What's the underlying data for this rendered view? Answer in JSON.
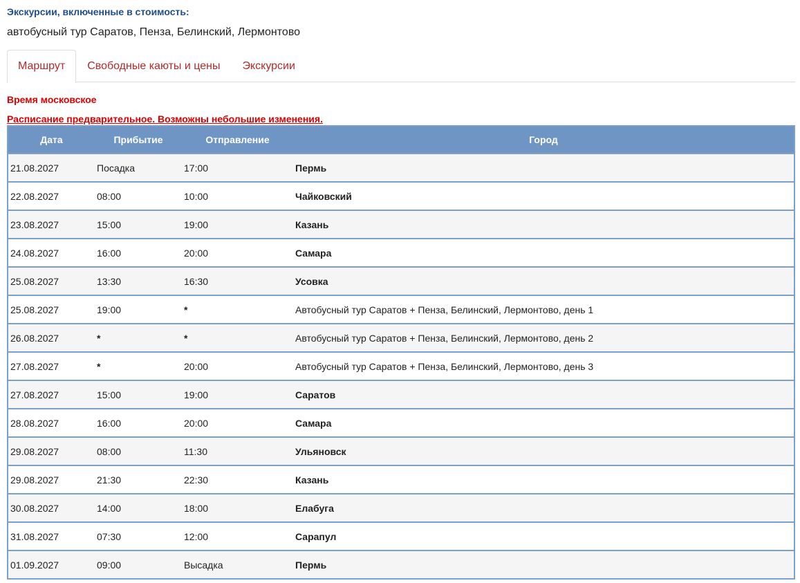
{
  "excursions": {
    "label": "Экскурсии, включенные в стоимость:",
    "text": "автобусный тур Саратов, Пенза, Белинский, Лермонтово"
  },
  "tabs": [
    {
      "label": "Маршрут",
      "active": true
    },
    {
      "label": "Свободные каюты и цены",
      "active": false
    },
    {
      "label": "Экскурсии",
      "active": false
    }
  ],
  "notes": {
    "time": "Время московское",
    "schedule": "Расписание предварительное. Возможны небольшие изменения."
  },
  "table": {
    "headers": [
      "Дата",
      "Прибытие",
      "Отправление",
      "Город"
    ],
    "rows": [
      {
        "date": "21.08.2027",
        "arrival": "Посадка",
        "departure": "17:00",
        "city": "Пермь",
        "type": "city"
      },
      {
        "date": "22.08.2027",
        "arrival": "08:00",
        "departure": "10:00",
        "city": "Чайковский",
        "type": "city"
      },
      {
        "date": "23.08.2027",
        "arrival": "15:00",
        "departure": "19:00",
        "city": "Казань",
        "type": "city"
      },
      {
        "date": "24.08.2027",
        "arrival": "16:00",
        "departure": "20:00",
        "city": "Самара",
        "type": "city"
      },
      {
        "date": "25.08.2027",
        "arrival": "13:30",
        "departure": "16:30",
        "city": "Усовка",
        "type": "city"
      },
      {
        "date": "25.08.2027",
        "arrival": "19:00",
        "departure": "*",
        "city": "Автобусный тур Саратов + Пенза, Белинский, Лермонтово, день 1",
        "type": "excursion"
      },
      {
        "date": "26.08.2027",
        "arrival": "*",
        "departure": "*",
        "city": "Автобусный тур Саратов + Пенза, Белинский, Лермонтово, день 2",
        "type": "excursion"
      },
      {
        "date": "27.08.2027",
        "arrival": "*",
        "departure": "20:00",
        "city": "Автобусный тур Саратов + Пенза, Белинский, Лермонтово, день 3",
        "type": "excursion"
      },
      {
        "date": "27.08.2027",
        "arrival": "15:00",
        "departure": "19:00",
        "city": "Саратов",
        "type": "city"
      },
      {
        "date": "28.08.2027",
        "arrival": "16:00",
        "departure": "20:00",
        "city": "Самара",
        "type": "city"
      },
      {
        "date": "29.08.2027",
        "arrival": "08:00",
        "departure": "11:30",
        "city": "Ульяновск",
        "type": "city"
      },
      {
        "date": "29.08.2027",
        "arrival": "21:30",
        "departure": "22:30",
        "city": "Казань",
        "type": "city"
      },
      {
        "date": "30.08.2027",
        "arrival": "14:00",
        "departure": "18:00",
        "city": "Елабуга",
        "type": "city"
      },
      {
        "date": "31.08.2027",
        "arrival": "07:30",
        "departure": "12:00",
        "city": "Сарапул",
        "type": "city"
      },
      {
        "date": "01.09.2027",
        "arrival": "09:00",
        "departure": "Высадка",
        "city": "Пермь",
        "type": "city"
      }
    ]
  },
  "colors": {
    "accent_blue": "#1f4e8c",
    "header_bg": "#6f95c4",
    "link_red": "#b52a2a",
    "alert_red": "#e00000"
  }
}
